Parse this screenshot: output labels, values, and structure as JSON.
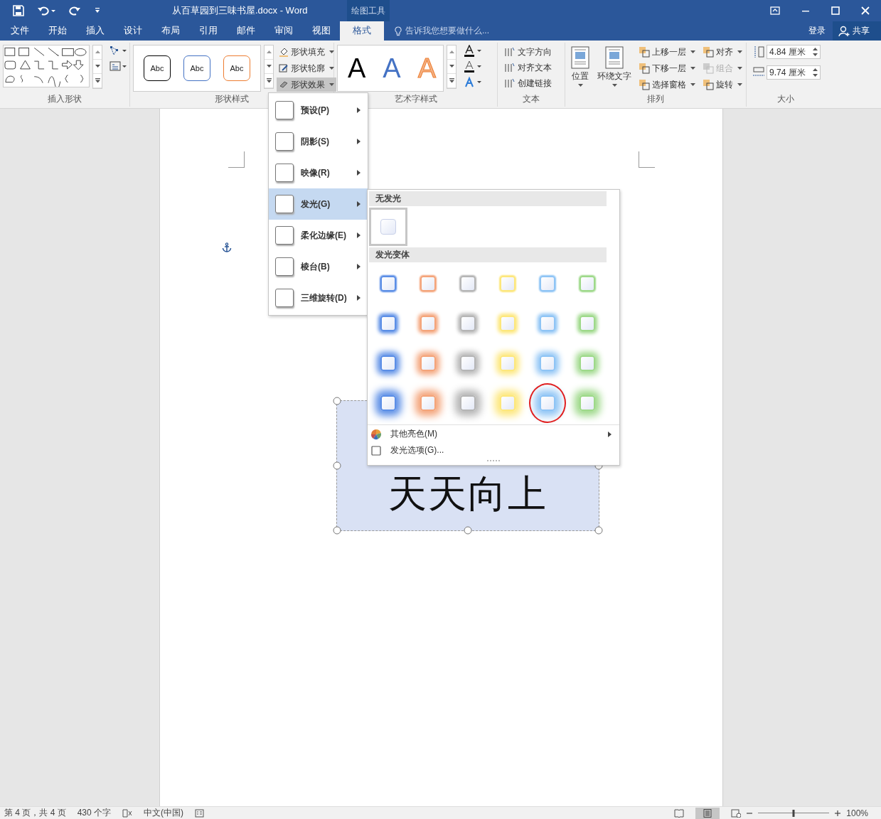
{
  "title_bar": {
    "title": "从百草园到三味书屋.docx - Word",
    "context_label": "绘图工具"
  },
  "tabs": [
    {
      "label": "文件",
      "selected": false
    },
    {
      "label": "开始",
      "selected": false
    },
    {
      "label": "插入",
      "selected": false
    },
    {
      "label": "设计",
      "selected": false
    },
    {
      "label": "布局",
      "selected": false
    },
    {
      "label": "引用",
      "selected": false
    },
    {
      "label": "邮件",
      "selected": false
    },
    {
      "label": "审阅",
      "selected": false
    },
    {
      "label": "视图",
      "selected": false
    },
    {
      "label": "格式",
      "selected": true
    }
  ],
  "tell_me": {
    "placeholder": "告诉我您想要做什么..."
  },
  "account": {
    "sign_in": "登录",
    "share": "共享"
  },
  "ribbon": {
    "insert_shapes": {
      "label": "插入形状"
    },
    "shape_styles": {
      "label": "形状样式",
      "presets": [
        {
          "text": "Abc",
          "color": "#000000"
        },
        {
          "text": "Abc",
          "color": "#4472c4"
        },
        {
          "text": "Abc",
          "color": "#ed7d31"
        }
      ],
      "commands": [
        {
          "label": "形状填充",
          "selected": false
        },
        {
          "label": "形状轮廓",
          "selected": false
        },
        {
          "label": "形状效果",
          "selected": true
        }
      ]
    },
    "wordart_styles": {
      "label": "艺术字样式",
      "presets": [
        {
          "text": "A",
          "color": "#000000"
        },
        {
          "text": "A",
          "color": "#4472c4"
        },
        {
          "text": "A",
          "color": "#f4b183"
        }
      ]
    },
    "text": {
      "label": "文本",
      "commands": [
        "文字方向",
        "对齐文本",
        "创建链接"
      ]
    },
    "arrange": {
      "label": "排列",
      "large": [
        "位置",
        "环绕文字"
      ],
      "commands": [
        {
          "label": "上移一层",
          "disabled": false
        },
        {
          "label": "对齐",
          "disabled": false
        },
        {
          "label": "下移一层",
          "disabled": false
        },
        {
          "label": "组合",
          "disabled": true
        },
        {
          "label": "选择窗格",
          "disabled": false
        },
        {
          "label": "旋转",
          "disabled": false
        }
      ]
    },
    "size": {
      "label": "大小",
      "height": "4.84 厘米",
      "width": "9.74 厘米"
    }
  },
  "effects_menu": [
    {
      "label": "预设(P)",
      "selected": false
    },
    {
      "label": "阴影(S)",
      "selected": false
    },
    {
      "label": "映像(R)",
      "selected": false
    },
    {
      "label": "发光(G)",
      "selected": true
    },
    {
      "label": "柔化边缘(E)",
      "selected": false
    },
    {
      "label": "棱台(B)",
      "selected": false
    },
    {
      "label": "三维旋转(D)",
      "selected": false
    }
  ],
  "glow_menu": {
    "no_glow_heading": "无发光",
    "variants_heading": "发光变体",
    "rows": [
      {
        "items": [
          {
            "color": "#5b8ee6",
            "marked": false
          },
          {
            "color": "#f4a47a",
            "marked": false
          },
          {
            "color": "#b5b5b5",
            "marked": false
          },
          {
            "color": "#fde77c",
            "marked": false
          },
          {
            "color": "#8ec4f5",
            "marked": false
          },
          {
            "color": "#9ed98a",
            "marked": false
          }
        ]
      },
      {
        "items": [
          {
            "color": "#5b8ee6",
            "marked": false
          },
          {
            "color": "#f4a47a",
            "marked": false
          },
          {
            "color": "#b5b5b5",
            "marked": false
          },
          {
            "color": "#fde77c",
            "marked": false
          },
          {
            "color": "#8ec4f5",
            "marked": false
          },
          {
            "color": "#9ed98a",
            "marked": false
          }
        ]
      },
      {
        "items": [
          {
            "color": "#5b8ee6",
            "marked": false
          },
          {
            "color": "#f4a47a",
            "marked": false
          },
          {
            "color": "#b5b5b5",
            "marked": false
          },
          {
            "color": "#fde77c",
            "marked": false
          },
          {
            "color": "#8ec4f5",
            "marked": false
          },
          {
            "color": "#9ed98a",
            "marked": false
          }
        ]
      },
      {
        "items": [
          {
            "color": "#5b8ee6",
            "marked": false
          },
          {
            "color": "#f4a47a",
            "marked": false
          },
          {
            "color": "#b5b5b5",
            "marked": false
          },
          {
            "color": "#fde77c",
            "marked": false
          },
          {
            "color": "#8ec4f5",
            "marked": true
          },
          {
            "color": "#9ed98a",
            "marked": false
          }
        ]
      }
    ],
    "more_colors": "其他亮色(M)",
    "options": "发光选项(G)..."
  },
  "document": {
    "shape_text": "天天向上"
  },
  "status_bar": {
    "page": "第 4 页，共 4 页",
    "words": "430 个字",
    "language": "中文(中国)",
    "zoom": "100%",
    "zoom_slider": {
      "level": 0.5
    }
  }
}
